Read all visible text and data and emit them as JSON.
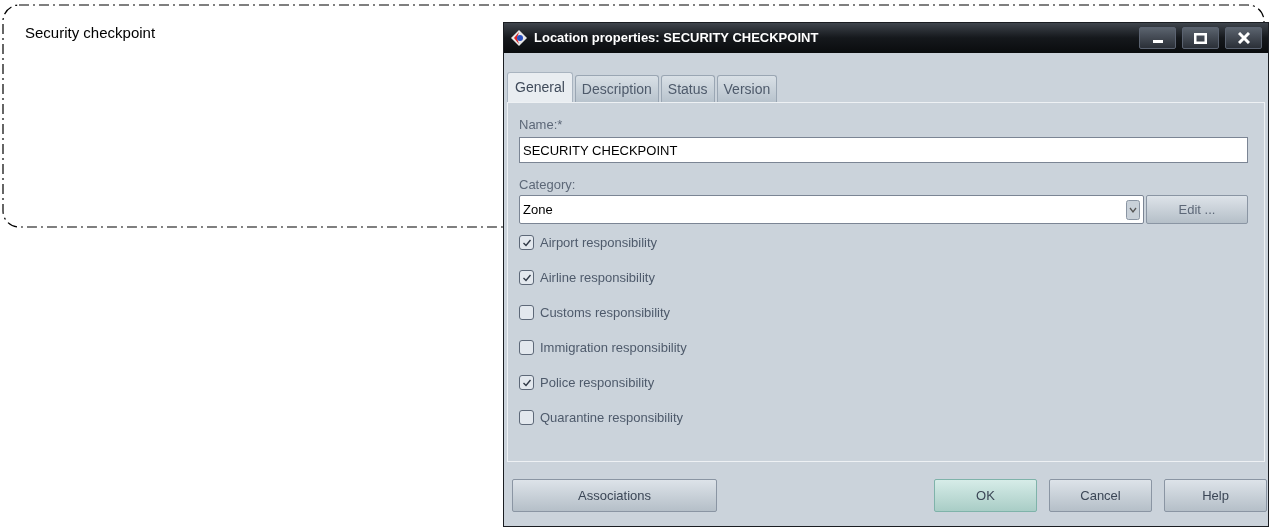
{
  "node": {
    "label": "Security checkpoint"
  },
  "window": {
    "title": "Location properties: SECURITY CHECKPOINT"
  },
  "tabs": [
    {
      "label": "General",
      "selected": true
    },
    {
      "label": "Description",
      "selected": false
    },
    {
      "label": "Status",
      "selected": false
    },
    {
      "label": "Version",
      "selected": false
    }
  ],
  "name_field": {
    "label": "Name:*",
    "value": "SECURITY CHECKPOINT"
  },
  "category_field": {
    "label": "Category:",
    "value": "Zone",
    "edit_button": "Edit ..."
  },
  "responsibilities": [
    {
      "label": "Airport responsibility",
      "checked": true
    },
    {
      "label": "Airline responsibility",
      "checked": true
    },
    {
      "label": "Customs responsibility",
      "checked": false
    },
    {
      "label": "Immigration responsibility",
      "checked": false
    },
    {
      "label": "Police responsibility",
      "checked": true
    },
    {
      "label": "Quarantine responsibility",
      "checked": false
    }
  ],
  "buttons": {
    "left": [
      {
        "label": "Associations",
        "kind": "normal"
      }
    ],
    "right": [
      {
        "label": "OK",
        "kind": "default"
      },
      {
        "label": "Cancel",
        "kind": "normal"
      },
      {
        "label": "Help",
        "kind": "normal"
      }
    ]
  }
}
